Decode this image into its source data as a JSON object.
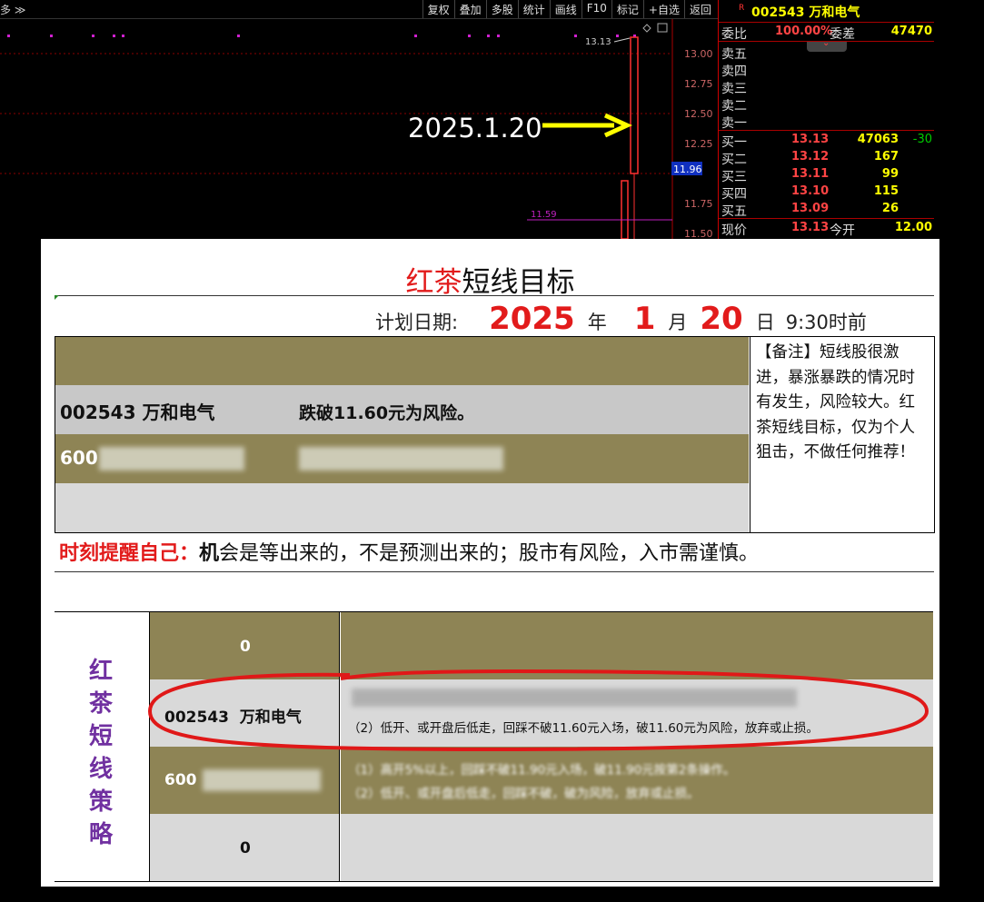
{
  "toolbar": {
    "crumb": "多 ≫",
    "buttons": [
      "复权",
      "叠加",
      "多股",
      "统计",
      "画线",
      "F10",
      "标记",
      "+自选",
      "返回"
    ]
  },
  "chart": {
    "price_ticks": [
      "13.00",
      "12.75",
      "12.50",
      "12.25",
      "11.75",
      "11.50"
    ],
    "current_price_tag": "11.96",
    "high_label": "13.13",
    "support_label": "11.59",
    "annotation": "2025.1.20"
  },
  "quote": {
    "r_mark": "R",
    "code_name": "002543 万和电气",
    "ratio_label": "委比",
    "ratio_value": "100.00%",
    "diff_label": "委差",
    "diff_value": "47470",
    "sells": [
      "卖五",
      "卖四",
      "卖三",
      "卖二",
      "卖一"
    ],
    "buys": [
      {
        "label": "买一",
        "price": "13.13",
        "vol": "47063",
        "chg": "-30"
      },
      {
        "label": "买二",
        "price": "13.12",
        "vol": "167",
        "chg": ""
      },
      {
        "label": "买三",
        "price": "13.11",
        "vol": "99",
        "chg": ""
      },
      {
        "label": "买四",
        "price": "13.10",
        "vol": "115",
        "chg": ""
      },
      {
        "label": "买五",
        "price": "13.09",
        "vol": "26",
        "chg": ""
      }
    ],
    "now_label": "现价",
    "now_price": "13.13",
    "open_label": "今开",
    "open_price": "12.00"
  },
  "doc": {
    "title_red": "红茶",
    "title_rest": "短线目标",
    "date_label": "计划日期:",
    "year": "2025",
    "year_unit": "年",
    "month": "1",
    "month_unit": "月",
    "day": "20",
    "day_unit": "日",
    "time": "9:30时前",
    "row1": {
      "stock": "002543 万和电气",
      "note": "跌破11.60元为风险。"
    },
    "row2": {
      "stock": "600"
    },
    "note": "【备注】短线股很激进，暴涨暴跌的情况时有发生，风险较大。红茶短线目标，仅为个人狙击，不做任何推荐！",
    "remind_red": "时刻提醒自己：",
    "remind_bold": "机",
    "remind_rest": "会是等出来的，不是预测出来的；股市有风险，入市需谨慎。",
    "strategy_title": [
      "红",
      "茶",
      "短",
      "线",
      "策",
      "略"
    ],
    "strategy_rows": [
      {
        "name": "0",
        "text": ""
      },
      {
        "name": "002543  万和电气",
        "text": "（2）低开、或开盘后低走，回踩不破11.60元入场，破11.60元为风险，放弃或止损。"
      },
      {
        "name": "600",
        "text_a": "（1）高开5%以上，回踩不破11.90元入场，破11.90元按第2条操作。",
        "text_b": "（2）低开、或开盘后低走，回踩不破，破为风险，放弃或止损。"
      },
      {
        "name": "0",
        "text": ""
      }
    ]
  },
  "colors": {
    "olive": "#8e8455",
    "gray": "#c8c8c8",
    "light": "#d9d9d9",
    "red": "#e21b1b",
    "purple": "#7030a0"
  }
}
